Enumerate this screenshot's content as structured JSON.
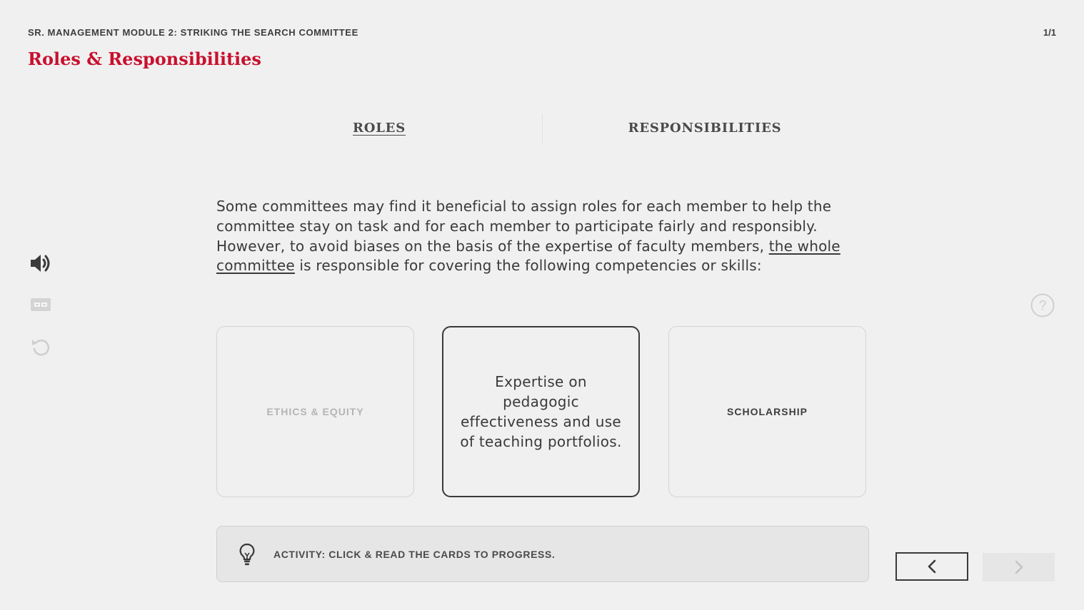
{
  "header": {
    "module_title": "SR. MANAGEMENT MODULE 2: STRIKING THE SEARCH COMMITTEE",
    "lesson_title": "Roles & Responsibilities",
    "page_counter": "1/1"
  },
  "tabs": [
    {
      "label": "ROLES",
      "active": true
    },
    {
      "label": "RESPONSIBILITIES",
      "active": false
    }
  ],
  "intro": {
    "part1": "Some committees may find it beneficial to assign roles for each member to help the committee stay on task and for each member to participate fairly and responsibly. However, to avoid biases on the basis of the expertise of faculty members, ",
    "link": "the whole committee",
    "part2": " is responsible for covering the following competencies or skills:"
  },
  "cards": [
    {
      "label": "ETHICS & EQUITY",
      "state": "visited"
    },
    {
      "text": "Expertise on pedagogic effectiveness and use of teaching portfolios.",
      "state": "open"
    },
    {
      "label": "SCHOLARSHIP",
      "state": "unvisited"
    }
  ],
  "activity": {
    "text": "ACTIVITY: CLICK & READ THE CARDS TO PROGRESS."
  },
  "side_controls": [
    "speaker-icon",
    "closed-captions-icon",
    "replay-icon"
  ],
  "help": {
    "icon": "help-icon"
  },
  "navigation": {
    "prev_icon": "chevron-left-icon",
    "next_icon": "chevron-right-icon",
    "next_enabled": false
  },
  "colors": {
    "accent": "#c8102e",
    "background": "#f0f0f0",
    "text": "#3c3c3c"
  }
}
